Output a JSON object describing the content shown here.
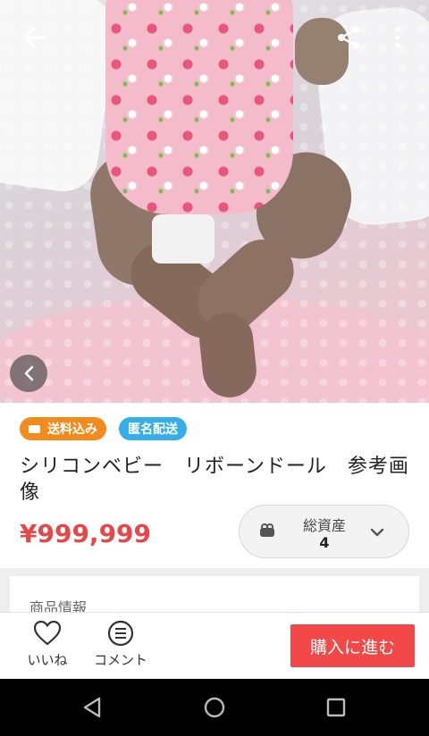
{
  "top_bar": {
    "back_icon": "arrow-left-icon",
    "share_icon": "share-icon",
    "more_icon": "more-vertical-icon"
  },
  "gallery": {
    "previous_icon": "chevron-left-icon"
  },
  "badges": {
    "shipping_included": "送料込み",
    "anonymous_shipping": "匿名配送"
  },
  "product": {
    "title": "シリコンベビー　リボーンドール　参考画像",
    "price": "¥999,999"
  },
  "assets_widget": {
    "label": "総資産",
    "count": "4",
    "icon": "purse-icon",
    "expand_icon": "chevron-down-icon"
  },
  "section": {
    "heading": "商品情報"
  },
  "actions": {
    "like_label": "いいね",
    "comment_label": "コメント",
    "buy_label": "購入に進む"
  },
  "system_nav": {
    "back": "triangle-back-icon",
    "home": "circle-home-icon",
    "recent": "square-recent-icon"
  },
  "colors": {
    "price": "#e8474a",
    "buy_button": "#f24848",
    "badge_shipping": "#f28a1c",
    "badge_anon": "#35aee8"
  }
}
